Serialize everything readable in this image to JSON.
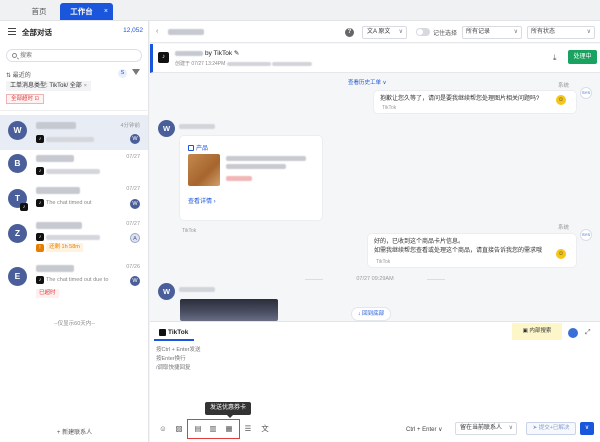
{
  "tabs": {
    "home": "首页",
    "workbench": "工作台",
    "close": "×"
  },
  "left": {
    "title": "全部对话",
    "count": "12,052",
    "search_placeholder": "搜索",
    "recent_label": "最近的",
    "recent_badge": "S",
    "filter_tag": "工单消息类型: TikTok/ 全部",
    "filter_tag_x": "×",
    "red_tag": "全部超时",
    "conversations": [
      {
        "initial": "W",
        "time": "4分钟前",
        "badge": "W",
        "color": "#4a5f99"
      },
      {
        "initial": "B",
        "time": "07/27",
        "badge": "",
        "color": "#4a5f99"
      },
      {
        "initial": "T",
        "time": "07/27",
        "badge": "W",
        "color": "#4a5f99",
        "message": "The chat timed out"
      },
      {
        "initial": "Z",
        "time": "07/27",
        "badge": "A",
        "color": "#4a5f99",
        "tag": "还剩 1h 58m"
      },
      {
        "initial": "E",
        "time": "07/26",
        "badge": "W",
        "color": "#4a5f99",
        "message": "The chat timed out due to",
        "tag": "已超时"
      }
    ],
    "more_link": "--仅显示60天内--",
    "new_contact": "+ 新建联系人"
  },
  "header": {
    "translate": "原文",
    "toggle_label": "记住选择",
    "filter_records": "所有记录",
    "filter_status": "所有状态"
  },
  "order": {
    "tt_label": "♪",
    "title_suffix": "by TikTok",
    "subtitle": "创建于 07/27 13:24PM",
    "process_btn": "处理中",
    "download": "⤓"
  },
  "chat": {
    "history_link": "查看历史工单 ∨",
    "system_label": "系统",
    "msg1": "抱歉让您久等了，请问是要我继续帮您处理图片相关问题吗?",
    "msg1_src": "TikTok",
    "product_label": "产品",
    "product_view": "查看详情 ›",
    "product_src": "TikTok",
    "msg2_line1": "好的，已收到这个商品卡片信息。",
    "msg2_line2": "如需我继续帮您查看或处理这个商品，请直接告诉我您的需求哦",
    "msg2_src": "TikTok",
    "time_sep": "07/27 09:29AM",
    "back_bottom": "↓ 回到底部"
  },
  "composer": {
    "tab": "TikTok",
    "inner_search": "内部搜索",
    "placeholder": "按Ctrl + Enter发送\n按Enter换行\n/调取快捷回复",
    "tooltip": "发送优惠券卡",
    "shortcut": "Ctrl + Enter",
    "assign": "留在当前联系人",
    "send": "提交+已解决",
    "send_more": "∨"
  }
}
